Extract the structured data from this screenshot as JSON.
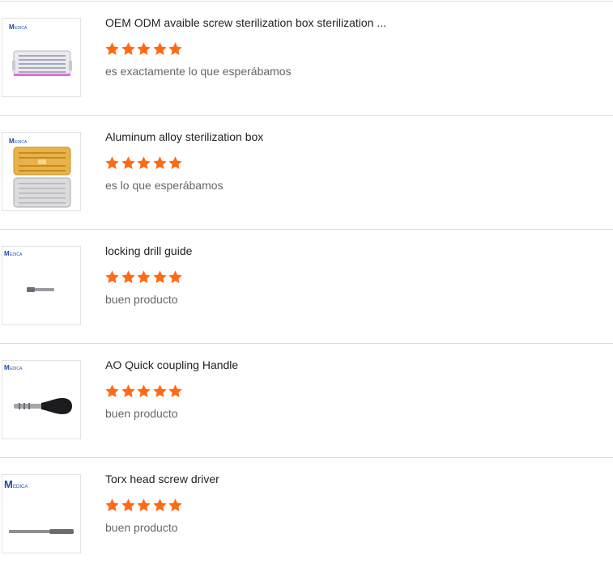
{
  "colors": {
    "star": "#ff6a13",
    "divider": "#dddddd"
  },
  "reviews": [
    {
      "title": "OEM ODM avaible screw sterilization box sterilization ...",
      "rating": 5,
      "comment": "es exactamente lo que esperábamos",
      "image_icon": "sterilization-tray-icon",
      "logo_text": "EDICA"
    },
    {
      "title": "Aluminum alloy sterilization box",
      "rating": 5,
      "comment": "es lo que esperábamos",
      "image_icon": "aluminum-box-icon",
      "logo_text": "EDICA"
    },
    {
      "title": "locking drill guide",
      "rating": 5,
      "comment": "buen producto",
      "image_icon": "drill-guide-icon",
      "logo_text": "EDICA"
    },
    {
      "title": "AO Quick coupling Handle",
      "rating": 5,
      "comment": "buen producto",
      "image_icon": "coupling-handle-icon",
      "logo_text": "EDICA"
    },
    {
      "title": "Torx head screw driver",
      "rating": 5,
      "comment": "buen producto",
      "image_icon": "screwdriver-icon",
      "logo_text": "EDICA"
    }
  ]
}
